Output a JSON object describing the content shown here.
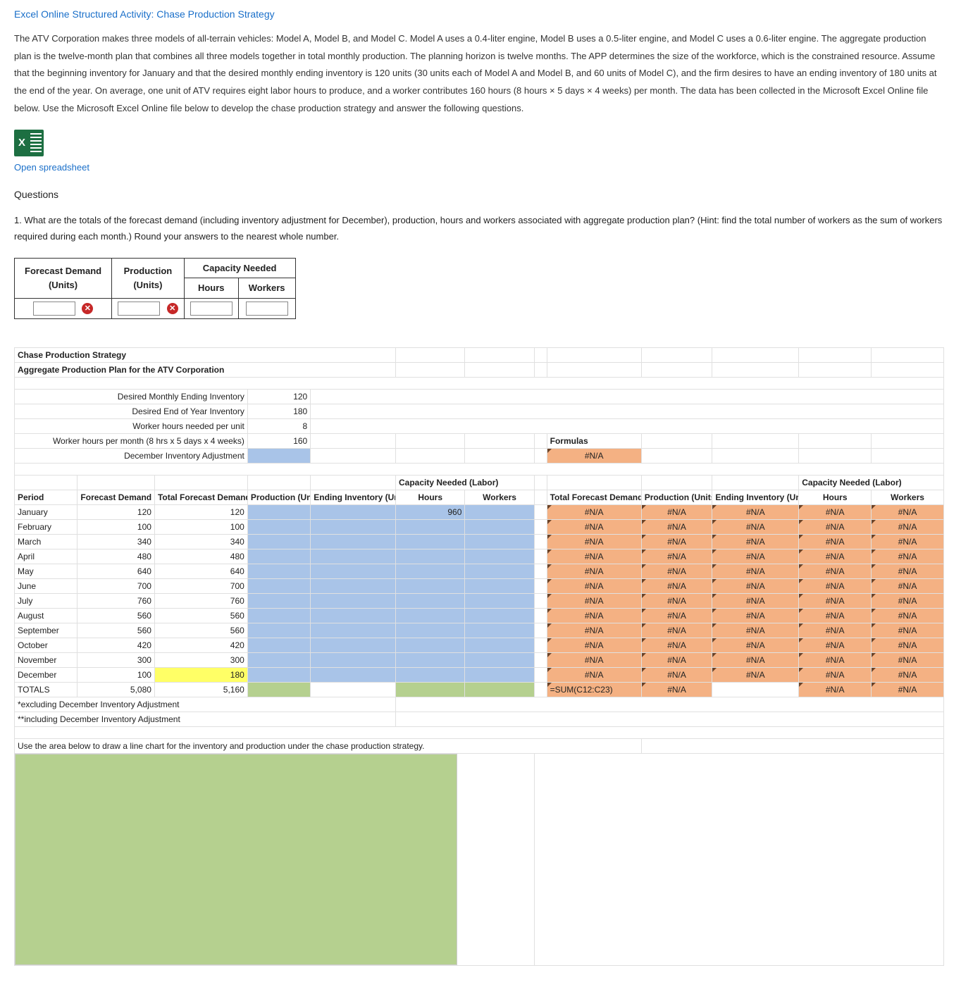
{
  "title_link": "Excel Online Structured Activity: Chase Production Strategy",
  "intro": "The ATV Corporation makes three models of all-terrain vehicles: Model A, Model B, and Model C. Model A uses a 0.4-liter engine, Model B uses a 0.5-liter engine, and Model C uses a 0.6-liter engine. The aggregate production plan is the twelve-month plan that combines all three models together in total monthly production. The planning horizon is twelve months. The APP determines the size of the workforce, which is the constrained resource. Assume that the beginning inventory for January and that the desired monthly ending inventory is 120 units (30 units each of Model A and Model B, and 60 units of Model C), and the firm desires to have an ending inventory of 180 units at the end of the year. On average, one unit of ATV requires eight labor hours to produce, and a worker contributes 160 hours (8 hours × 5 days × 4 weeks) per month. The data has been collected in the Microsoft Excel Online file below. Use the Microsoft Excel Online file below to develop the chase production strategy and answer the following questions.",
  "open_spreadsheet": "Open spreadsheet",
  "questions_label": "Questions",
  "question1": "1. What are the totals of the forecast demand (including inventory adjustment for December), production, hours and workers associated with aggregate production plan? (Hint: find the total number of workers as the sum of workers required during each month.) Round your answers to the nearest whole number.",
  "ans_headers": {
    "fd": "Forecast Demand",
    "fd_sub": "(Units)",
    "prod": "Production",
    "prod_sub": "(Units)",
    "cap": "Capacity Needed",
    "hours": "Hours",
    "workers": "Workers"
  },
  "sheet": {
    "title1": "Chase Production Strategy",
    "title2": "Aggregate Production Plan for the ATV Corporation",
    "params": {
      "p1_label": "Desired Monthly Ending Inventory",
      "p1_val": "120",
      "p2_label": "Desired End of Year Inventory",
      "p2_val": "180",
      "p3_label": "Worker hours needed per unit",
      "p3_val": "8",
      "p4_label": "Worker hours per month (8 hrs x 5 days x 4 weeks)",
      "p4_val": "160",
      "p5_label": "December Inventory Adjustment"
    },
    "formulas_label": "Formulas",
    "cap_header": "Capacity Needed (Labor)",
    "col_headers": {
      "period": "Period",
      "fd": "Forecast Demand (Units)*",
      "tfd": "Total Forecast Demand (Units)**",
      "prod": "Production (Units)",
      "ei": "Ending Inventory (Units)",
      "hours": "Hours",
      "workers": "Workers"
    },
    "val960": "960",
    "rows": [
      {
        "period": "January",
        "fd": "120",
        "tfd": "120"
      },
      {
        "period": "February",
        "fd": "100",
        "tfd": "100"
      },
      {
        "period": "March",
        "fd": "340",
        "tfd": "340"
      },
      {
        "period": "April",
        "fd": "480",
        "tfd": "480"
      },
      {
        "period": "May",
        "fd": "640",
        "tfd": "640"
      },
      {
        "period": "June",
        "fd": "700",
        "tfd": "700"
      },
      {
        "period": "July",
        "fd": "760",
        "tfd": "760"
      },
      {
        "period": "August",
        "fd": "560",
        "tfd": "560"
      },
      {
        "period": "September",
        "fd": "560",
        "tfd": "560"
      },
      {
        "period": "October",
        "fd": "420",
        "tfd": "420"
      },
      {
        "period": "November",
        "fd": "300",
        "tfd": "300"
      },
      {
        "period": "December",
        "fd": "100",
        "tfd": "180"
      }
    ],
    "totals": {
      "label": "TOTALS",
      "fd": "5,080",
      "tfd": "5,160"
    },
    "na": "#N/A",
    "sum_formula": "=SUM(C12:C23)",
    "foot1": "*excluding December Inventory Adjustment",
    "foot2": "**including December Inventory Adjustment",
    "chart_caption": "Use the area below to draw a line chart for the inventory and production under the chase production strategy."
  },
  "icons": {
    "excel_x": "X",
    "wrong": "✕"
  }
}
